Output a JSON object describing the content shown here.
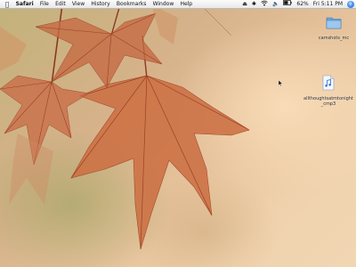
{
  "menubar": {
    "app_name": "Safari",
    "items": [
      "File",
      "Edit",
      "View",
      "History",
      "Bookmarks",
      "Window",
      "Help"
    ],
    "battery": "62%",
    "clock": "Fri 5:11 PM"
  },
  "desktop": {
    "icons": [
      {
        "label": "camshots_mc",
        "kind": "folder-icon"
      },
      {
        "label": "allthoughtsatmtonight_cmp3",
        "kind": "audio-file-icon"
      }
    ]
  }
}
